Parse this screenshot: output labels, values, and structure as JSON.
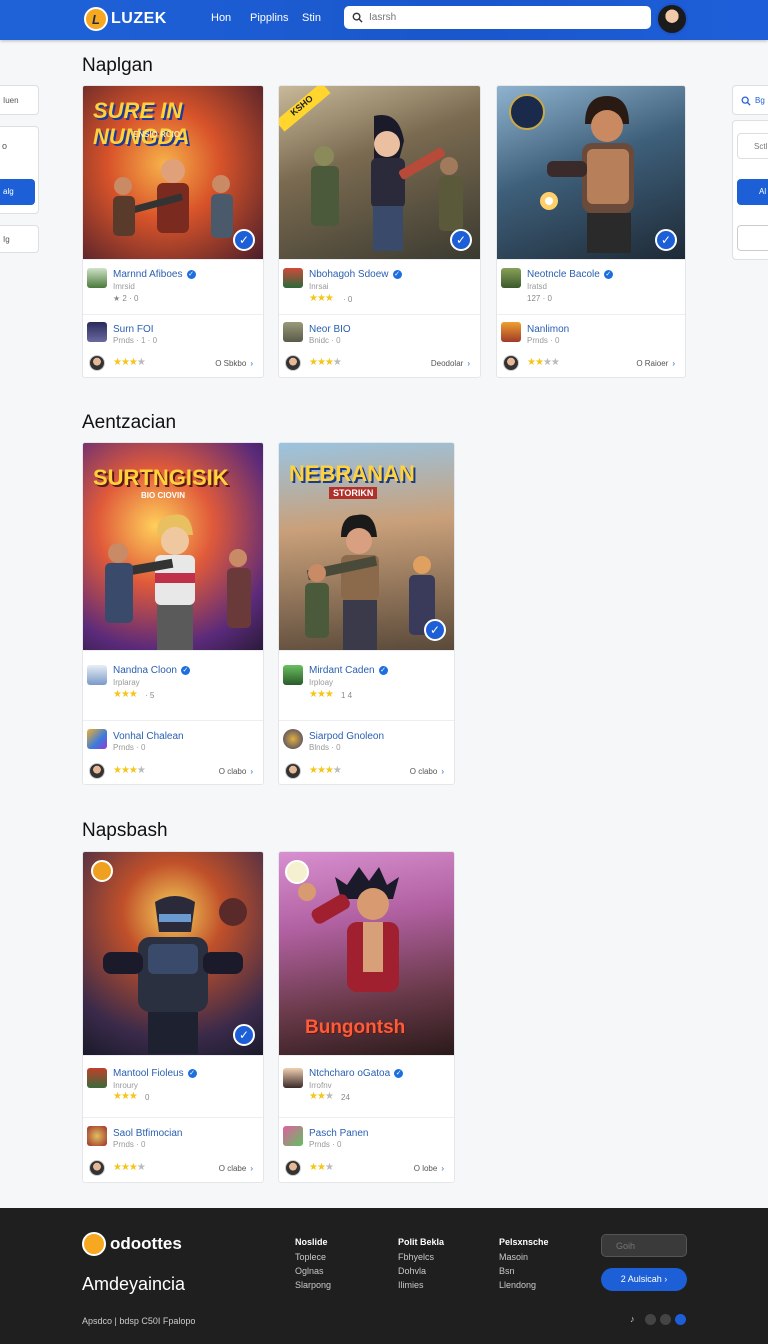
{
  "header": {
    "logo_text": "LUZEK",
    "nav": [
      "Hon",
      "Pipplins",
      "Stin"
    ],
    "search_placeholder": "Iasrsh"
  },
  "sections": [
    {
      "title": "Naplgan",
      "cards": [
        {
          "art_title": "SURE IN NUNGDA",
          "art_sub": "ENSIO RCIO",
          "row1": {
            "title": "Marnnd Afiboes",
            "sub": "Imrsid",
            "meta": "★ 2 · 0"
          },
          "row2": {
            "title": "Surn FOI",
            "sub": "Prnds · 1 · 0"
          },
          "link": "O Sbkbo"
        },
        {
          "art_title": "",
          "art_ribbon": "KSHO",
          "row1": {
            "title": "Nbohagoh Sdoew",
            "sub": "Inrsai",
            "meta": "· 0"
          },
          "row2": {
            "title": "Neor BIO",
            "sub": "Bnidc · 0"
          },
          "link": "Deodolar"
        },
        {
          "art_title": "",
          "row1": {
            "title": "Neotncle Bacole",
            "sub": "Iratsd",
            "meta": "127 · 0"
          },
          "row2": {
            "title": "Nanlimon",
            "sub": "Prnds · 0"
          },
          "link": "O Raioer"
        }
      ]
    },
    {
      "title": "Aentzacian",
      "cards": [
        {
          "art_title": "SURTNGISIK",
          "art_sub": "BIO CIOVIN",
          "row1": {
            "title": "Nandna Cloon",
            "sub": "Irplaray",
            "meta": "· 5"
          },
          "row2": {
            "title": "Vonhal Chalean",
            "sub": "Prnds · 0"
          },
          "link": "O clabo"
        },
        {
          "art_title": "NEBRANAN",
          "art_sub": "STORIKN",
          "row1": {
            "title": "Mirdant Caden",
            "sub": "Irploay",
            "meta": "1 4"
          },
          "row2": {
            "title": "Siarpod Gnoleon",
            "sub": "Blnds · 0"
          },
          "link": "O clabo"
        }
      ]
    },
    {
      "title": "Napsbash",
      "cards": [
        {
          "art_title": "",
          "row1": {
            "title": "Mantool Fioleus",
            "sub": "Inroury",
            "meta": "0"
          },
          "row2": {
            "title": "Saol Btfimocian",
            "sub": "Prnds · 0"
          },
          "link": "O clabe"
        },
        {
          "art_title": "Bungontsh",
          "row1": {
            "title": "Ntchcharo oGatoa",
            "sub": "Irrofnv",
            "meta": "24"
          },
          "row2": {
            "title": "Pasch Panen",
            "sub": "Prnds · 0"
          },
          "link": "O lobe"
        }
      ]
    }
  ],
  "side_left": [
    "Iuen",
    "",
    "alg",
    "Ig"
  ],
  "side_right": [
    "Bg",
    "Sctl",
    "Al",
    ""
  ],
  "footer": {
    "brand": "odoottes",
    "tagline": "Amdeyaincia",
    "col1": {
      "head": "Noslide",
      "items": [
        "Toplece",
        "Oglnas",
        "Slarpong"
      ]
    },
    "col2": {
      "head": "Polit Bekla",
      "items": [
        "Fbhyelcs",
        "Dohvla",
        "Ilimies"
      ]
    },
    "col3": {
      "head": "Pelsxnsche",
      "items": [
        "Masoin",
        "Bsn",
        "Llendong"
      ]
    },
    "input_placeholder": "Goih",
    "button_label": "2 Aulsicah",
    "legal": "Apsdco | bdsp C50I Fpalopo"
  }
}
